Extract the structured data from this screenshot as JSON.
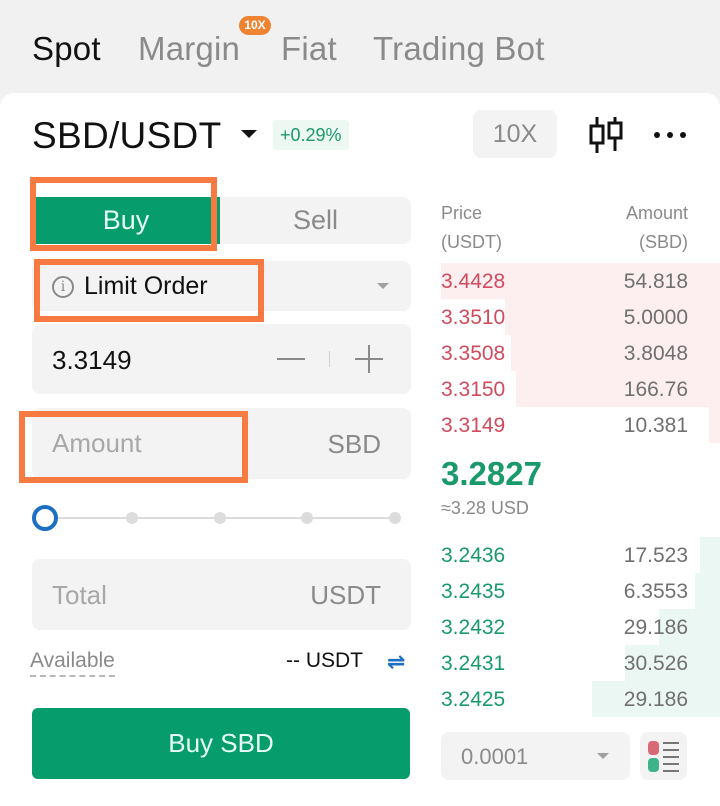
{
  "tabs": [
    {
      "label": "Spot",
      "active": true
    },
    {
      "label": "Margin",
      "badge": "10X"
    },
    {
      "label": "Fiat"
    },
    {
      "label": "Trading Bot"
    }
  ],
  "header": {
    "pair": "SBD/USDT",
    "change": "+0.29%",
    "leverage_label": "10X",
    "icons": [
      "candlestick-chart-icon",
      "more-icon"
    ]
  },
  "colors": {
    "buy_green": "#079c6c",
    "ask_red": "#d04b5c",
    "bid_green": "#1a9a6b",
    "highlight_orange": "#f77a42",
    "accent_blue": "#1d6fc4"
  },
  "form": {
    "buy_label": "Buy",
    "sell_label": "Sell",
    "order_type": "Limit Order",
    "price_value": "3.3149",
    "amount_placeholder": "Amount",
    "amount_value": "",
    "amount_unit": "SBD",
    "slider_percent": 0,
    "total_placeholder": "Total",
    "total_unit": "USDT",
    "available_label": "Available",
    "available_value": "-- USDT",
    "submit_label": "Buy SBD"
  },
  "orderbook": {
    "price_header": "Price",
    "price_unit": "(USDT)",
    "amount_header": "Amount",
    "amount_unit": "(SBD)",
    "asks": [
      {
        "price": "3.4428",
        "amount": "54.818",
        "depth": 1.0
      },
      {
        "price": "3.3510",
        "amount": "5.0000",
        "depth": 0.77
      },
      {
        "price": "3.3508",
        "amount": "3.8048",
        "depth": 0.75
      },
      {
        "price": "3.3150",
        "amount": "166.76",
        "depth": 0.73
      },
      {
        "price": "3.3149",
        "amount": "10.381",
        "depth": 0.04
      }
    ],
    "mid_price": "3.2827",
    "mid_usd": "≈3.28 USD",
    "bids": [
      {
        "price": "3.2436",
        "amount": "17.523",
        "depth": 0.07
      },
      {
        "price": "3.2435",
        "amount": "6.3553",
        "depth": 0.09
      },
      {
        "price": "3.2432",
        "amount": "29.186",
        "depth": 0.22
      },
      {
        "price": "3.2431",
        "amount": "30.526",
        "depth": 0.34
      },
      {
        "price": "3.2425",
        "amount": "29.186",
        "depth": 0.46
      }
    ],
    "precision": "0.0001"
  }
}
